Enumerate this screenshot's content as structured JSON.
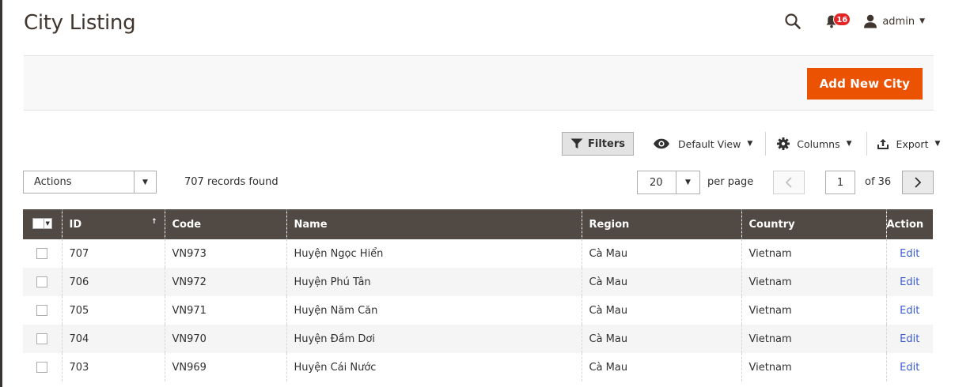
{
  "page": {
    "title": "City Listing"
  },
  "header": {
    "notifications_count": "16",
    "user_name": "admin"
  },
  "action_bar": {
    "add_button_label": "Add New City"
  },
  "grid_tools": {
    "filters_label": "Filters",
    "view_label": "Default View",
    "columns_label": "Columns",
    "export_label": "Export"
  },
  "mass_actions": {
    "label": "Actions"
  },
  "records_found": "707 records found",
  "pagination": {
    "per_page_value": "20",
    "per_page_label": "per page",
    "current_page": "1",
    "of_label": "of 36"
  },
  "table": {
    "columns": [
      "ID",
      "Code",
      "Name",
      "Region",
      "Country",
      "Action"
    ],
    "rows": [
      {
        "id": "707",
        "code": "VN973",
        "name": "Huyện Ngọc Hiển",
        "region": "Cà Mau",
        "country": "Vietnam",
        "action": "Edit"
      },
      {
        "id": "706",
        "code": "VN972",
        "name": "Huyện Phú Tân",
        "region": "Cà Mau",
        "country": "Vietnam",
        "action": "Edit"
      },
      {
        "id": "705",
        "code": "VN971",
        "name": "Huyện Năm Căn",
        "region": "Cà Mau",
        "country": "Vietnam",
        "action": "Edit"
      },
      {
        "id": "704",
        "code": "VN970",
        "name": "Huyện Đầm Dơi",
        "region": "Cà Mau",
        "country": "Vietnam",
        "action": "Edit"
      },
      {
        "id": "703",
        "code": "VN969",
        "name": "Huyện Cái Nước",
        "region": "Cà Mau",
        "country": "Vietnam",
        "action": "Edit"
      }
    ]
  },
  "colors": {
    "accent": "#eb5202",
    "table_header": "#514943",
    "link": "#3b5ec9",
    "badge": "#e22626"
  }
}
